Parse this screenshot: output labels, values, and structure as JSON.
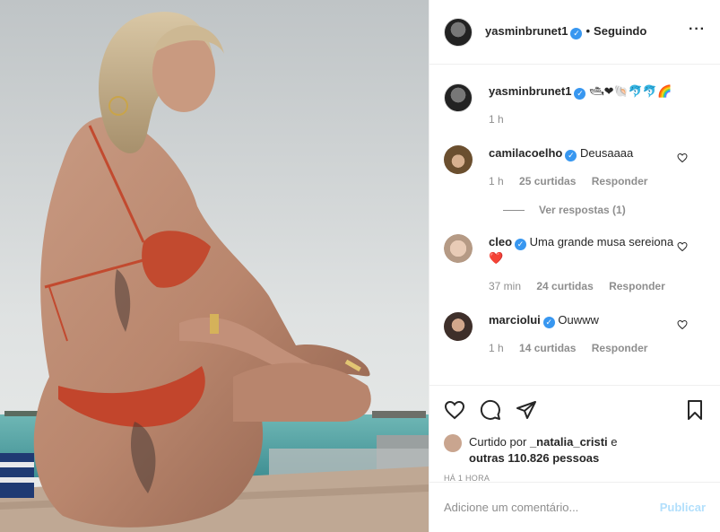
{
  "post": {
    "author": "yasminbrunet1",
    "follow_status": "Seguindo",
    "dot": "•",
    "caption_emojis": "🛥❤🐚🐬🐬🌈",
    "caption_time": "1 h"
  },
  "comments": [
    {
      "user": "camilacoelho",
      "text": "Deusaaaa",
      "time": "1 h",
      "likes": "25 curtidas",
      "reply": "Responder"
    },
    {
      "user": "cleo",
      "text": "Uma grande musa sereiona❤️",
      "time": "37 min",
      "likes": "24 curtidas",
      "reply": "Responder"
    },
    {
      "user": "marciolui",
      "text": "Ouwww",
      "time": "1 h",
      "likes": "14 curtidas",
      "reply": "Responder"
    }
  ],
  "view_replies": "Ver respostas (1)",
  "likes": {
    "prefix": "Curtido por",
    "user": "_natalia_cristi",
    "mid": "e",
    "others": "outras 110.826 pessoas"
  },
  "time_ago": "HÁ 1 HORA",
  "add_comment": {
    "placeholder": "Adicione um comentário...",
    "post_label": "Publicar"
  },
  "colors": {
    "verified": "#3897f0",
    "muted": "#8e8e8e",
    "publish_disabled": "#b2dffc",
    "heart_red": "#ed4956"
  }
}
